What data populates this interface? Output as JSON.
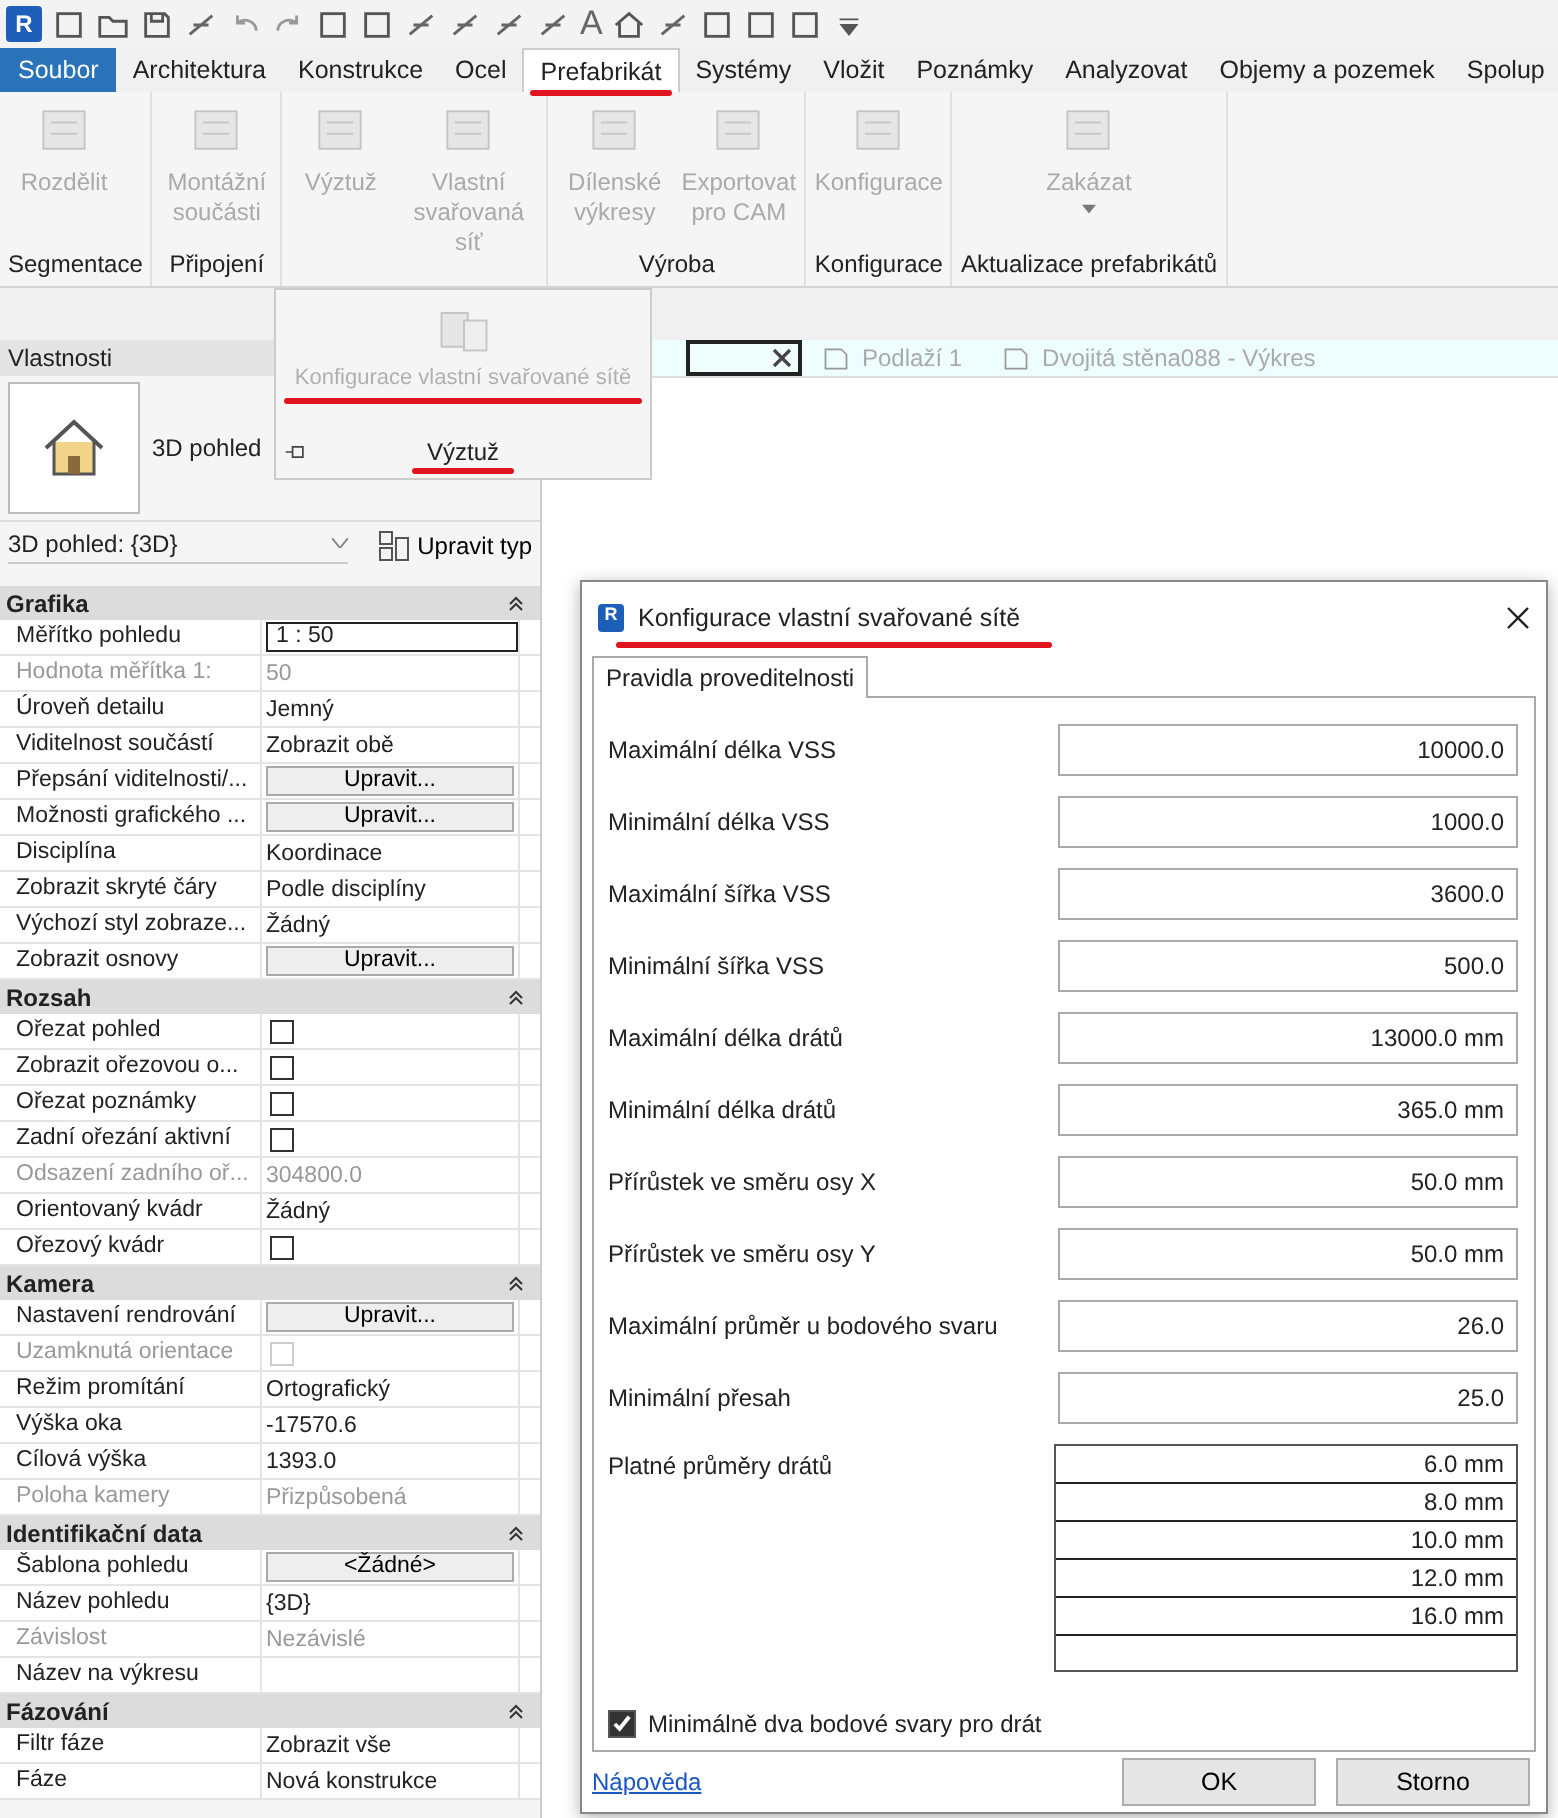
{
  "app_logo": "R",
  "quick_access": {
    "text_tool_glyph": "A"
  },
  "ribbon_tabs": [
    {
      "label": "Soubor",
      "kind": "file",
      "selected": false
    },
    {
      "label": "Architektura",
      "kind": "tab",
      "selected": false
    },
    {
      "label": "Konstrukce",
      "kind": "tab",
      "selected": false
    },
    {
      "label": "Ocel",
      "kind": "tab",
      "selected": false
    },
    {
      "label": "Prefabrikát",
      "kind": "tab",
      "selected": true
    },
    {
      "label": "Systémy",
      "kind": "tab",
      "selected": false
    },
    {
      "label": "Vložit",
      "kind": "tab",
      "selected": false
    },
    {
      "label": "Poznámky",
      "kind": "tab",
      "selected": false
    },
    {
      "label": "Analyzovat",
      "kind": "tab",
      "selected": false
    },
    {
      "label": "Objemy a pozemek",
      "kind": "tab",
      "selected": false
    },
    {
      "label": "Spolup",
      "kind": "tab",
      "selected": false
    }
  ],
  "ribbon_panels": [
    {
      "label": "Segmentace",
      "buttons": [
        {
          "label": "Rozdělit",
          "disabled": true
        }
      ]
    },
    {
      "label": "Připojení",
      "buttons": [
        {
          "label": "Montážní součásti",
          "disabled": true
        }
      ]
    },
    {
      "buttons": [
        {
          "label": "Výztuž",
          "disabled": true
        },
        {
          "label": "Vlastní svařovaná síť",
          "disabled": true
        }
      ]
    },
    {
      "label": "Výroba",
      "buttons": [
        {
          "label": "Dílenské výkresy",
          "disabled": true
        },
        {
          "label": "Exportovat pro CAM",
          "disabled": true
        }
      ]
    },
    {
      "label": "Konfigurace",
      "buttons": [
        {
          "label": "Konfigurace",
          "disabled": true
        }
      ]
    },
    {
      "label": "Aktualizace prefabrikátů",
      "buttons": [
        {
          "label": "Zakázat",
          "disabled": true,
          "dropdown": true
        }
      ]
    }
  ],
  "flyout": {
    "button": "Konfigurace vlastní svařované sítě",
    "disabled": true,
    "panel_label": "Výztuž"
  },
  "view_tabs": [
    {
      "selected": true
    },
    {
      "label": "Podlaží 1",
      "selected": false
    },
    {
      "label": "Dvojitá stěna088 - Výkres",
      "selected": false
    }
  ],
  "properties": {
    "title": "Vlastnosti",
    "type_name": "3D pohled",
    "selector": "3D pohled: {3D}",
    "edit_type": "Upravit typ",
    "groups": [
      {
        "label": "Grafika",
        "rows": [
          {
            "label": "Měřítko pohledu",
            "kind": "input",
            "value": "1 : 50",
            "disabled": false
          },
          {
            "label": "Hodnota měřítka    1:",
            "kind": "text",
            "value": "50",
            "disabled": true
          },
          {
            "label": "Úroveň detailu",
            "kind": "text",
            "value": "Jemný",
            "disabled": false
          },
          {
            "label": "Viditelnost součástí",
            "kind": "text",
            "value": "Zobrazit obě",
            "disabled": false
          },
          {
            "label": "Přepsání viditelnosti/...",
            "kind": "button",
            "value": "Upravit...",
            "disabled": false
          },
          {
            "label": "Možnosti grafického ...",
            "kind": "button",
            "value": "Upravit...",
            "disabled": false
          },
          {
            "label": "Disciplína",
            "kind": "text",
            "value": "Koordinace",
            "disabled": false
          },
          {
            "label": "Zobrazit skryté čáry",
            "kind": "text",
            "value": "Podle disciplíny",
            "disabled": false
          },
          {
            "label": "Výchozí styl zobraze...",
            "kind": "text",
            "value": "Žádný",
            "disabled": false
          },
          {
            "label": "Zobrazit osnovy",
            "kind": "button",
            "value": "Upravit...",
            "disabled": false
          }
        ]
      },
      {
        "label": "Rozsah",
        "rows": [
          {
            "label": "Ořezat pohled",
            "kind": "checkbox",
            "checked": false,
            "disabled": false
          },
          {
            "label": "Zobrazit ořezovou o...",
            "kind": "checkbox",
            "checked": false,
            "disabled": false
          },
          {
            "label": "Ořezat poznámky",
            "kind": "checkbox",
            "checked": false,
            "disabled": false
          },
          {
            "label": "Zadní ořezání aktivní",
            "kind": "checkbox",
            "checked": false,
            "disabled": false
          },
          {
            "label": "Odsazení zadního oř...",
            "kind": "text",
            "value": "304800.0",
            "disabled": true
          },
          {
            "label": "Orientovaný kvádr",
            "kind": "text",
            "value": "Žádný",
            "disabled": false
          },
          {
            "label": "Ořezový kvádr",
            "kind": "checkbox",
            "checked": false,
            "disabled": false
          }
        ]
      },
      {
        "label": "Kamera",
        "rows": [
          {
            "label": "Nastavení rendrování",
            "kind": "button",
            "value": "Upravit...",
            "disabled": false
          },
          {
            "label": "Uzamknutá orientace",
            "kind": "checkbox",
            "checked": false,
            "disabled": true
          },
          {
            "label": "Režim promítání",
            "kind": "text",
            "value": "Ortografický",
            "disabled": false
          },
          {
            "label": "Výška oka",
            "kind": "text",
            "value": "-17570.6",
            "disabled": false
          },
          {
            "label": "Cílová výška",
            "kind": "text",
            "value": "1393.0",
            "disabled": false
          },
          {
            "label": "Poloha kamery",
            "kind": "text",
            "value": "Přizpůsobená",
            "disabled": true
          }
        ]
      },
      {
        "label": "Identifikační data",
        "rows": [
          {
            "label": "Šablona pohledu",
            "kind": "button",
            "value": "<Žádné>",
            "disabled": false
          },
          {
            "label": "Název pohledu",
            "kind": "text",
            "value": "{3D}",
            "disabled": false
          },
          {
            "label": "Závislost",
            "kind": "text",
            "value": "Nezávislé",
            "disabled": true
          },
          {
            "label": "Název na výkresu",
            "kind": "text",
            "value": "",
            "disabled": false
          }
        ]
      },
      {
        "label": "Fázování",
        "rows": [
          {
            "label": "Filtr fáze",
            "kind": "text",
            "value": "Zobrazit vše",
            "disabled": false
          },
          {
            "label": "Fáze",
            "kind": "text",
            "value": "Nová konstrukce",
            "disabled": false
          }
        ]
      }
    ]
  },
  "dialog": {
    "logo": "R",
    "title": "Konfigurace vlastní svařované sítě",
    "tab": "Pravidla proveditelnosti",
    "fields": [
      {
        "label": "Maximální délka VSS",
        "value": "10000.0"
      },
      {
        "label": "Minimální délka VSS",
        "value": "1000.0"
      },
      {
        "label": "Maximální šířka VSS",
        "value": "3600.0"
      },
      {
        "label": "Minimální šířka VSS",
        "value": "500.0"
      },
      {
        "label": "Maximální délka drátů",
        "value": "13000.0 mm"
      },
      {
        "label": "Minimální délka drátů",
        "value": "365.0 mm"
      },
      {
        "label": "Přírůstek ve směru osy X",
        "value": "50.0 mm"
      },
      {
        "label": "Přírůstek ve směru osy Y",
        "value": "50.0 mm"
      },
      {
        "label": "Maximální průměr u bodového svaru",
        "value": "26.0"
      },
      {
        "label": "Minimální přesah",
        "value": "25.0"
      }
    ],
    "diameters_label": "Platné průměry drátů",
    "diameters": [
      "6.0 mm",
      "8.0 mm",
      "10.0 mm",
      "12.0 mm",
      "16.0 mm"
    ],
    "min_two_welds": {
      "label": "Minimálně dva bodové svary pro drát",
      "checked": true
    },
    "help": "Nápověda",
    "buttons": [
      "OK",
      "Storno"
    ]
  }
}
